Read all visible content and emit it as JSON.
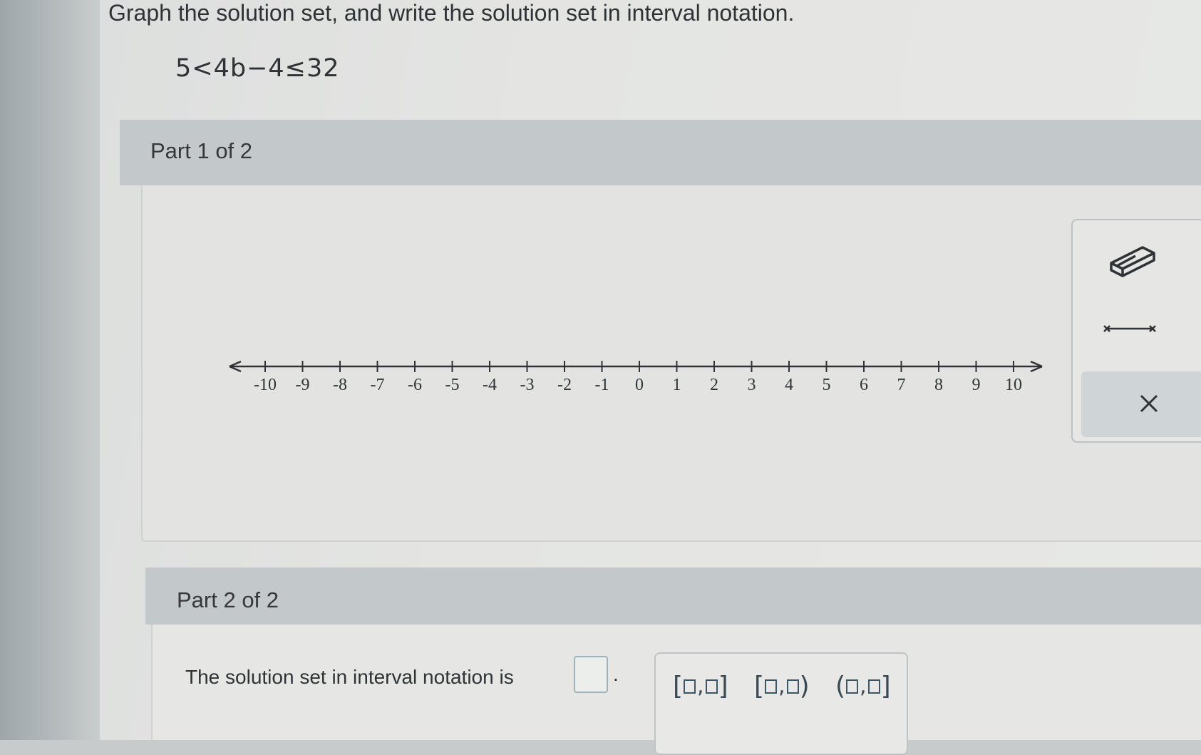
{
  "question": {
    "instruction": "Graph the solution set, and write the solution set in interval notation.",
    "inequality": "5<4b−4≤32"
  },
  "part1": {
    "title": "Part 1 of 2",
    "number_line": {
      "ticks": [
        "-10",
        "-9",
        "-8",
        "-7",
        "-6",
        "-5",
        "-4",
        "-3",
        "-2",
        "-1",
        "0",
        "1",
        "2",
        "3",
        "4",
        "5",
        "6",
        "7",
        "8",
        "9",
        "10"
      ]
    },
    "tools": {
      "eraser_icon": "eraser-icon",
      "segment_icon": "segment-tool-icon",
      "clear_icon": "close-icon"
    }
  },
  "part2": {
    "title": "Part 2 of 2",
    "answer_label": "The solution set in interval notation is",
    "answer_value": "",
    "period": ".",
    "templates": [
      {
        "left": "[",
        "sep": ",",
        "right": "]"
      },
      {
        "left": "[",
        "sep": ",",
        "right": ")"
      },
      {
        "left": "(",
        "sep": ",",
        "right": "]"
      }
    ]
  }
}
